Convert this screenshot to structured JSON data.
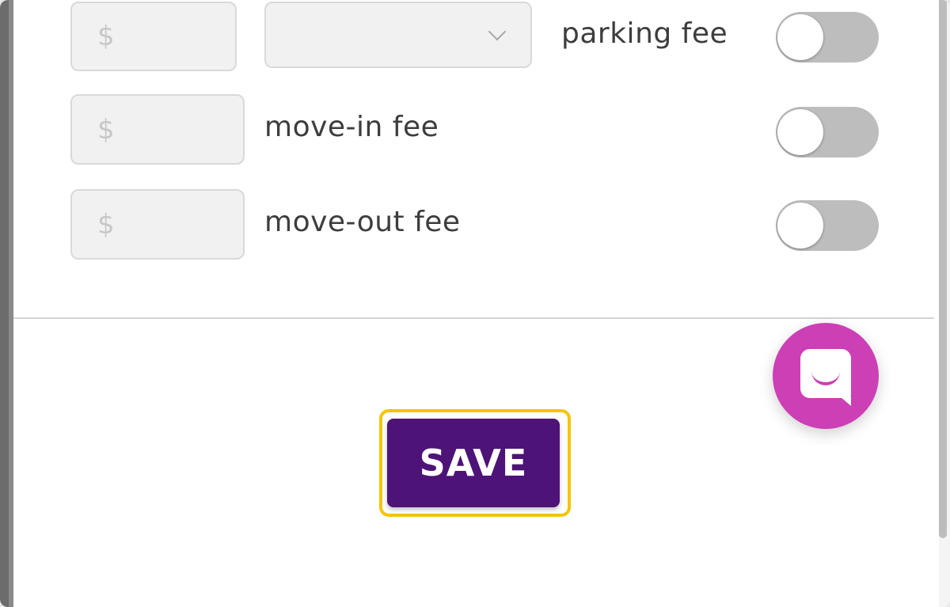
{
  "fees": {
    "currency_placeholder": "$",
    "items": [
      {
        "label": "parking fee",
        "amount": "",
        "enabled": false,
        "select_value": ""
      },
      {
        "label": "move-in fee",
        "amount": "",
        "enabled": false
      },
      {
        "label": "move-out fee",
        "amount": "",
        "enabled": false
      }
    ]
  },
  "actions": {
    "save_label": "SAVE"
  },
  "chat": {
    "icon": "chat-bubble-smile-icon"
  },
  "colors": {
    "save_button": "#4d1377",
    "highlight": "#f5c400",
    "chat_fab": "#cc3fb5",
    "toggle_off": "#bdbdbd"
  }
}
